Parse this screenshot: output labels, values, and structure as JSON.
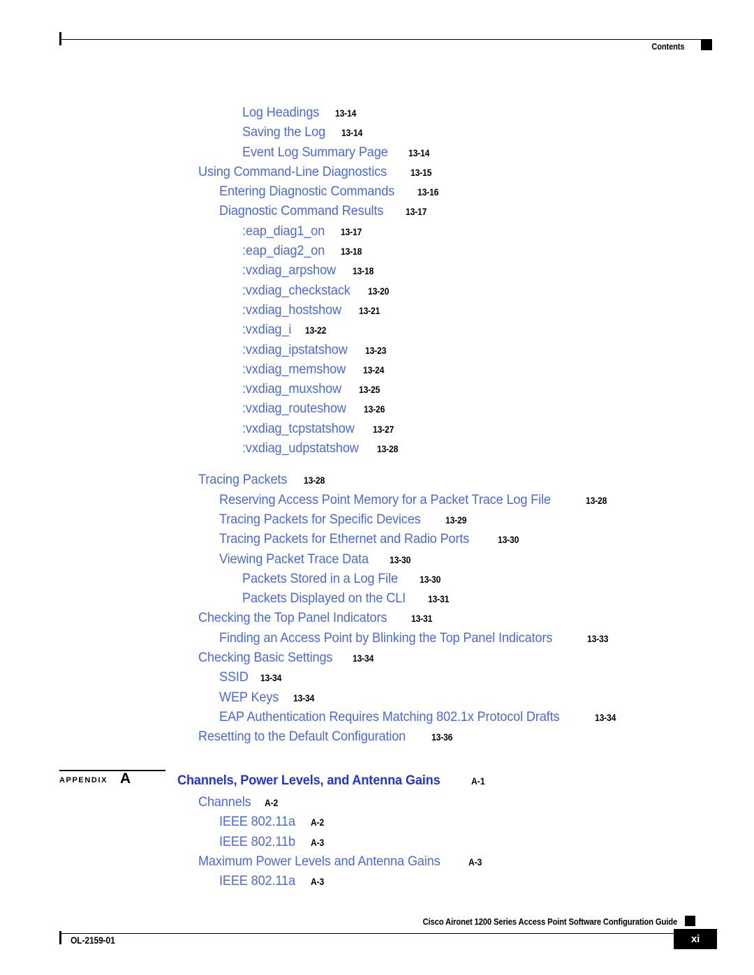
{
  "header": {
    "title": "Contents",
    "marker_icon": "black-square-marker"
  },
  "colors": {
    "link_blue": "#4a68e0",
    "appendix_title_blue": "#2233dd",
    "text_black": "#000000",
    "page_background": "#ffffff"
  },
  "toc": {
    "entries": [
      {
        "level": 3,
        "title": "Log Headings",
        "page": "13-14"
      },
      {
        "level": 3,
        "title": "Saving the Log",
        "page": "13-14"
      },
      {
        "level": 3,
        "title": "Event Log Summary Page",
        "page": "13-14"
      },
      {
        "level": 1,
        "title": "Using Command-Line Diagnostics",
        "page": "13-15"
      },
      {
        "level": 2,
        "title": "Entering Diagnostic Commands",
        "page": "13-16"
      },
      {
        "level": 2,
        "title": "Diagnostic Command Results",
        "page": "13-17"
      },
      {
        "level": 3,
        "title": ":eap_diag1_on",
        "page": "13-17"
      },
      {
        "level": 3,
        "title": ":eap_diag2_on",
        "page": "13-18"
      },
      {
        "level": 3,
        "title": ":vxdiag_arpshow",
        "page": "13-18"
      },
      {
        "level": 3,
        "title": ":vxdiag_checkstack",
        "page": "13-20"
      },
      {
        "level": 3,
        "title": ":vxdiag_hostshow",
        "page": "13-21"
      },
      {
        "level": 3,
        "title": ":vxdiag_i",
        "page": "13-22"
      },
      {
        "level": 3,
        "title": ":vxdiag_ipstatshow",
        "page": "13-23"
      },
      {
        "level": 3,
        "title": ":vxdiag_memshow",
        "page": "13-24"
      },
      {
        "level": 3,
        "title": ":vxdiag_muxshow",
        "page": "13-25"
      },
      {
        "level": 3,
        "title": ":vxdiag_routeshow",
        "page": "13-26"
      },
      {
        "level": 3,
        "title": ":vxdiag_tcpstatshow",
        "page": "13-27"
      },
      {
        "level": 3,
        "title": ":vxdiag_udpstatshow",
        "page": "13-28"
      },
      {
        "level": 1,
        "title": "Tracing Packets",
        "page": "13-28",
        "gap_before": true
      },
      {
        "level": 2,
        "title": "Reserving Access Point Memory for a Packet Trace Log File",
        "page": "13-28"
      },
      {
        "level": 2,
        "title": "Tracing Packets for Specific Devices",
        "page": "13-29"
      },
      {
        "level": 2,
        "title": "Tracing Packets for Ethernet and Radio Ports",
        "page": "13-30"
      },
      {
        "level": 2,
        "title": "Viewing Packet Trace Data",
        "page": "13-30"
      },
      {
        "level": 3,
        "title": "Packets Stored in a Log File",
        "page": "13-30"
      },
      {
        "level": 3,
        "title": "Packets Displayed on the CLI",
        "page": "13-31"
      },
      {
        "level": 1,
        "title": "Checking the Top Panel Indicators",
        "page": "13-31"
      },
      {
        "level": 2,
        "title": "Finding an Access Point by Blinking the Top Panel Indicators",
        "page": "13-33"
      },
      {
        "level": 1,
        "title": "Checking Basic Settings",
        "page": "13-34"
      },
      {
        "level": 2,
        "title": "SSID",
        "page": "13-34"
      },
      {
        "level": 2,
        "title": "WEP Keys",
        "page": "13-34"
      },
      {
        "level": 2,
        "title": "EAP Authentication Requires Matching 802.1x Protocol Drafts",
        "page": "13-34"
      },
      {
        "level": 1,
        "title": "Resetting to the Default Configuration",
        "page": "13-36"
      }
    ]
  },
  "appendix": {
    "label": "APPENDIX",
    "letter": "A",
    "title": "Channels, Power Levels, and Antenna Gains",
    "page": "A-1",
    "entries": [
      {
        "level": 1,
        "title": "Channels",
        "page": "A-2"
      },
      {
        "level": 2,
        "title": "IEEE 802.11a",
        "page": "A-2"
      },
      {
        "level": 2,
        "title": "IEEE 802.11b",
        "page": "A-3"
      },
      {
        "level": 1,
        "title": "Maximum Power Levels and Antenna Gains",
        "page": "A-3"
      },
      {
        "level": 2,
        "title": "IEEE 802.11a",
        "page": "A-3"
      }
    ]
  },
  "footer": {
    "guide_title": "Cisco Aironet 1200 Series Access Point Software Configuration Guide",
    "doc_id": "OL-2159-01",
    "page_number": "xi",
    "marker_icon": "black-square-marker"
  }
}
